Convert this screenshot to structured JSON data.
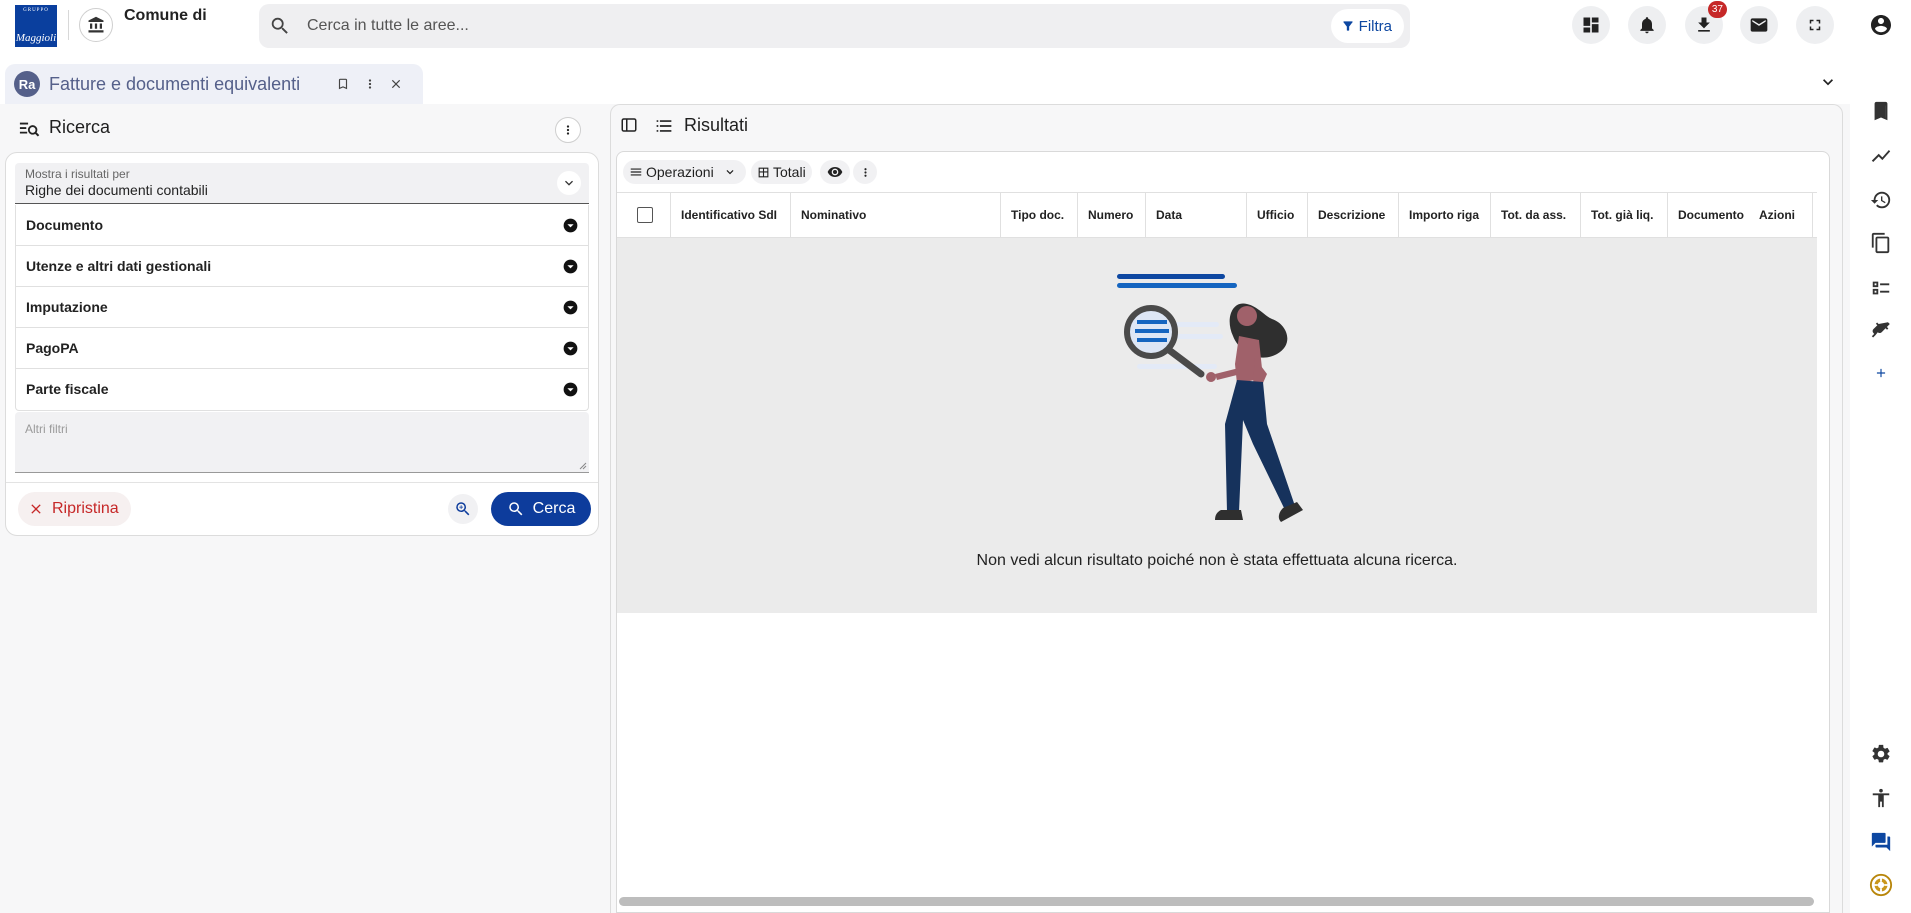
{
  "app": {
    "logo_top": "GRUPPO",
    "logo_brand": "Maggioli",
    "org_name": "Comune di"
  },
  "search": {
    "placeholder": "Cerca in tutte le aree...",
    "filter_label": "Filtra"
  },
  "topbar": {
    "downloads_badge": "37"
  },
  "tab": {
    "icon_text": "Ra",
    "title": "Fatture e documenti equivalenti"
  },
  "left_panel": {
    "title": "Ricerca",
    "show_results_label": "Mostra i risultati per",
    "show_results_value": "Righe dei documenti contabili",
    "sections": [
      {
        "label": "Documento"
      },
      {
        "label": "Utenze e altri dati gestionali"
      },
      {
        "label": "Imputazione"
      },
      {
        "label": "PagoPA"
      },
      {
        "label": "Parte fiscale"
      }
    ],
    "other_filters_placeholder": "Altri filtri",
    "reset_label": "Ripristina",
    "search_label": "Cerca"
  },
  "results": {
    "title": "Risultati",
    "toolbar": {
      "operations_label": "Operazioni",
      "totals_label": "Totali"
    },
    "columns": [
      "Identificativo SdI",
      "Nominativo",
      "Tipo doc.",
      "Numero",
      "Data",
      "Ufficio",
      "Descrizione",
      "Importo riga",
      "Tot. da ass.",
      "Tot. già liq.",
      "Documento",
      "Azioni"
    ],
    "empty_message": "Non vedi alcun risultato poiché non è stata effettuata alcuna ricerca."
  },
  "colors": {
    "brand": "#0a3f9e",
    "primary_button": "#0d3c9c",
    "reset": "#c62828",
    "tab_text": "#55608a"
  }
}
